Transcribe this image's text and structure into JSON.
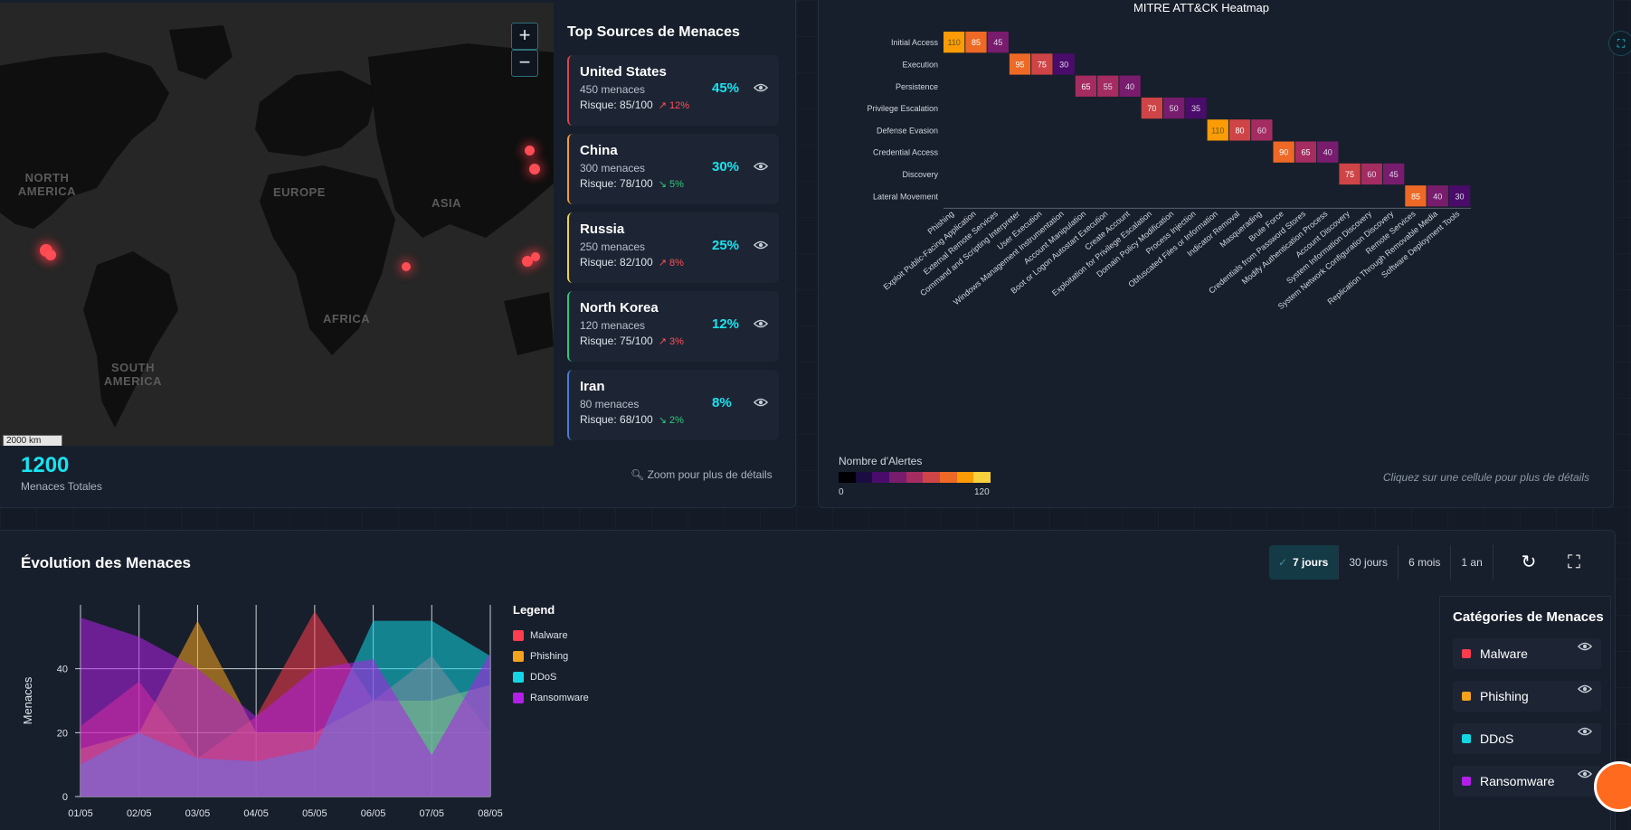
{
  "map": {
    "zoom_in": "+",
    "zoom_out": "−",
    "labels": [
      {
        "text": "NORTH\nAMERICA"
      },
      {
        "text": "EUROPE"
      },
      {
        "text": "ASIA"
      },
      {
        "text": "AFRICA"
      },
      {
        "text": "SOUTH\nAMERICA"
      }
    ],
    "scale": "2000 km"
  },
  "sources": {
    "title": "Top Sources de Menaces",
    "items": [
      {
        "country": "United States",
        "count": "450 menaces",
        "risk": "Risque: 85/100",
        "trend": "12%",
        "trend_dir": "up",
        "pct": "45%",
        "color": "#e0434e"
      },
      {
        "country": "China",
        "count": "300 menaces",
        "risk": "Risque: 78/100",
        "trend": "5%",
        "trend_dir": "down",
        "pct": "30%",
        "color": "#f0a020"
      },
      {
        "country": "Russia",
        "count": "250 menaces",
        "risk": "Risque: 82/100",
        "trend": "8%",
        "trend_dir": "up",
        "pct": "25%",
        "color": "#f3d23a"
      },
      {
        "country": "North Korea",
        "count": "120 menaces",
        "risk": "Risque: 75/100",
        "trend": "3%",
        "trend_dir": "up",
        "pct": "12%",
        "color": "#2ec77a"
      },
      {
        "country": "Iran",
        "count": "80 menaces",
        "risk": "Risque: 68/100",
        "trend": "2%",
        "trend_dir": "down",
        "pct": "8%",
        "color": "#4a7bd8"
      }
    ]
  },
  "totals": {
    "value": "1200",
    "label": "Menaces Totales",
    "zoom_hint": "Zoom pour plus de détails"
  },
  "heatmap": {
    "title": "MITRE ATT&CK Heatmap",
    "tactics": [
      "Initial Access",
      "Execution",
      "Persistence",
      "Privilege Escalation",
      "Defense Evasion",
      "Credential Access",
      "Discovery",
      "Lateral Movement"
    ],
    "techniques": [
      "Phishing",
      "Exploit Public-Facing Application",
      "External Remote Services",
      "Command and Scripting Interpreter",
      "User Execution",
      "Windows Management Instrumentation",
      "Account Manipulation",
      "Boot or Logon Autostart Execution",
      "Create Account",
      "Exploitation for Privilege Escalation",
      "Domain Policy Modification",
      "Process Injection",
      "Obfuscated Files or Information",
      "Indicator Removal",
      "Masquerading",
      "Brute Force",
      "Credentials from Password Stores",
      "Modify Authentication Process",
      "Account Discovery",
      "System Information Discovery",
      "System Network Configuration Discovery",
      "Remote Services",
      "Replication Through Removable Media",
      "Software Deployment Tools"
    ],
    "values": [
      [
        110,
        85,
        45
      ],
      [
        95,
        75,
        30
      ],
      [
        65,
        55,
        40
      ],
      [
        70,
        50,
        35
      ],
      [
        110,
        80,
        60
      ],
      [
        90,
        65,
        40
      ],
      [
        75,
        60,
        45
      ],
      [
        85,
        40,
        30
      ]
    ],
    "legend_title": "Nombre d'Alertes",
    "legend_min": "0",
    "legend_max": "120",
    "legend_colors": [
      "#000004",
      "#1b0c41",
      "#4a0c6b",
      "#781c6d",
      "#a52c60",
      "#cf4446",
      "#ed6925",
      "#fb9b06",
      "#f7d13d"
    ],
    "hint": "Cliquez sur une cellule pour plus de détails"
  },
  "evolution": {
    "title": "Évolution des Menaces",
    "periods": [
      "7 jours",
      "30 jours",
      "6 mois",
      "1 an"
    ],
    "legend_title": "Legend",
    "categories_title": "Catégories de Menaces"
  },
  "chart_data": {
    "type": "area",
    "x": [
      "01/05",
      "02/05",
      "03/05",
      "04/05",
      "05/05",
      "06/05",
      "07/05",
      "08/05"
    ],
    "ylabel": "Menaces",
    "ylim": [
      0,
      60
    ],
    "yticks": [
      0,
      20,
      40
    ],
    "series": [
      {
        "name": "Malware",
        "color": "#ff3b4e",
        "values": [
          22,
          36,
          12,
          25,
          58,
          30,
          44,
          20
        ]
      },
      {
        "name": "Phishing",
        "color": "#f5a21d",
        "values": [
          15,
          20,
          55,
          20,
          20,
          30,
          30,
          35
        ]
      },
      {
        "name": "DDoS",
        "color": "#12d6e3",
        "values": [
          10,
          20,
          12,
          11,
          15,
          55,
          55,
          44
        ]
      },
      {
        "name": "Ransomware",
        "color": "#b21fe8",
        "values": [
          56,
          50,
          40,
          25,
          40,
          43,
          13,
          45
        ]
      }
    ]
  }
}
